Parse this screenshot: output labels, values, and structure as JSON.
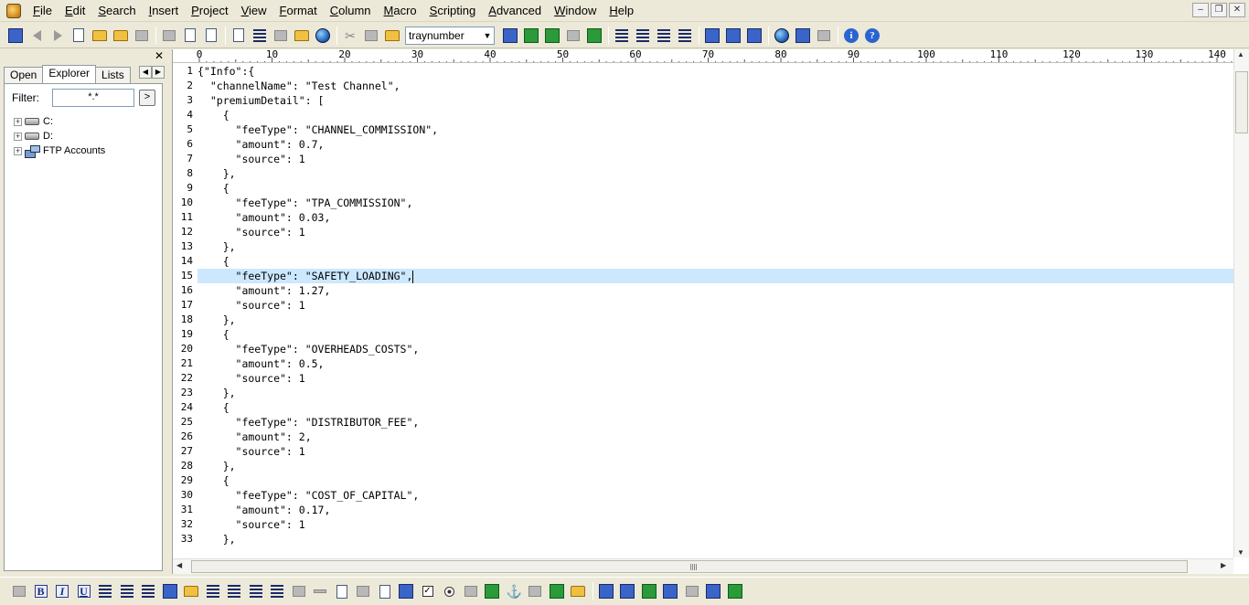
{
  "menu": {
    "items": [
      "File",
      "Edit",
      "Search",
      "Insert",
      "Project",
      "View",
      "Format",
      "Column",
      "Macro",
      "Scripting",
      "Advanced",
      "Window",
      "Help"
    ]
  },
  "window_controls": [
    "–",
    "❐",
    "✕"
  ],
  "toolbar": {
    "search_combo_value": "traynumber"
  },
  "left_panel": {
    "tabs": [
      "Open",
      "Explorer",
      "Lists"
    ],
    "active_tab": "Explorer",
    "filter_label": "Filter:",
    "filter_value": "*.*",
    "filter_button": ">",
    "tree": [
      {
        "label": "C:",
        "type": "drive"
      },
      {
        "label": "D:",
        "type": "drive"
      },
      {
        "label": "FTP Accounts",
        "type": "ftp"
      }
    ]
  },
  "ruler": {
    "labels": [
      "0",
      "10",
      "20",
      "30",
      "40",
      "50",
      "60",
      "70",
      "80",
      "90",
      "100",
      "110",
      "120",
      "130",
      "140"
    ]
  },
  "editor": {
    "highlighted_line": 15,
    "lines": [
      "{\"Info\":{",
      "  \"channelName\": \"Test Channel\",",
      "  \"premiumDetail\": [",
      "    {",
      "      \"feeType\": \"CHANNEL_COMMISSION\",",
      "      \"amount\": 0.7,",
      "      \"source\": 1",
      "    },",
      "    {",
      "      \"feeType\": \"TPA_COMMISSION\",",
      "      \"amount\": 0.03,",
      "      \"source\": 1",
      "    },",
      "    {",
      "      \"feeType\": \"SAFETY_LOADING\",",
      "      \"amount\": 1.27,",
      "      \"source\": 1",
      "    },",
      "    {",
      "      \"feeType\": \"OVERHEADS_COSTS\",",
      "      \"amount\": 0.5,",
      "      \"source\": 1",
      "    },",
      "    {",
      "      \"feeType\": \"DISTRIBUTOR_FEE\",",
      "      \"amount\": 2,",
      "      \"source\": 1",
      "    },",
      "    {",
      "      \"feeType\": \"COST_OF_CAPITAL\",",
      "      \"amount\": 0.17,",
      "      \"source\": 1",
      "    },"
    ]
  },
  "colors": {
    "highlight": "#cce8ff",
    "chrome": "#ece9d8",
    "accent": "#316ac5"
  }
}
